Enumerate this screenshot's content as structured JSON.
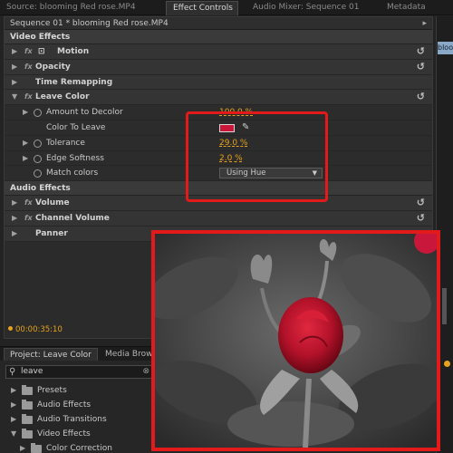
{
  "tabs": [
    {
      "label": "Source: blooming Red rose.MP4",
      "active": false
    },
    {
      "label": "Effect Controls",
      "active": true,
      "close": "×"
    },
    {
      "label": "Audio Mixer: Sequence 01",
      "active": false
    },
    {
      "label": "Metadata",
      "active": false
    }
  ],
  "effect_controls": {
    "sequence_label": "Sequence 01 * blooming Red rose.MP4",
    "arrow": "▸",
    "video_effects_heading": "Video Effects",
    "audio_effects_heading": "Audio Effects",
    "video_effects": [
      {
        "name": "Motion"
      },
      {
        "name": "Opacity"
      },
      {
        "name": "Time Remapping"
      },
      {
        "name": "Leave Color"
      }
    ],
    "leave_color_props": {
      "amount": {
        "label": "Amount to Decolor",
        "value": "100.0 %"
      },
      "color": {
        "label": "Color To Leave",
        "color": "#c8173a"
      },
      "tolerance": {
        "label": "Tolerance",
        "value": "29.0 %"
      },
      "edge": {
        "label": "Edge Softness",
        "value": "2.0 %"
      },
      "match": {
        "label": "Match colors",
        "value": "Using Hue"
      }
    },
    "audio_effects": [
      {
        "name": "Volume"
      },
      {
        "name": "Channel Volume"
      },
      {
        "name": "Panner"
      }
    ],
    "timecode": "00:00:35:10"
  },
  "right_monitor": {
    "clip_label": "bloo"
  },
  "project_panel": {
    "tabs": [
      {
        "label": "Project: Leave Color",
        "active": true
      },
      {
        "label": "Media Brow",
        "active": false
      }
    ],
    "search_value": "leave",
    "tree": [
      {
        "label": "Presets",
        "level": 0
      },
      {
        "label": "Audio Effects",
        "level": 0
      },
      {
        "label": "Audio Transitions",
        "level": 0
      },
      {
        "label": "Video Effects",
        "level": 0,
        "expanded": true
      },
      {
        "label": "Color Correction",
        "level": 1
      }
    ]
  },
  "accent_colors": {
    "highlight": "#e21a1a",
    "value": "#e8a21b",
    "rose": "#c8173a"
  },
  "icons": [
    "reset-icon",
    "eyedropper-icon",
    "stopwatch-icon",
    "folder-icon",
    "search-icon"
  ]
}
